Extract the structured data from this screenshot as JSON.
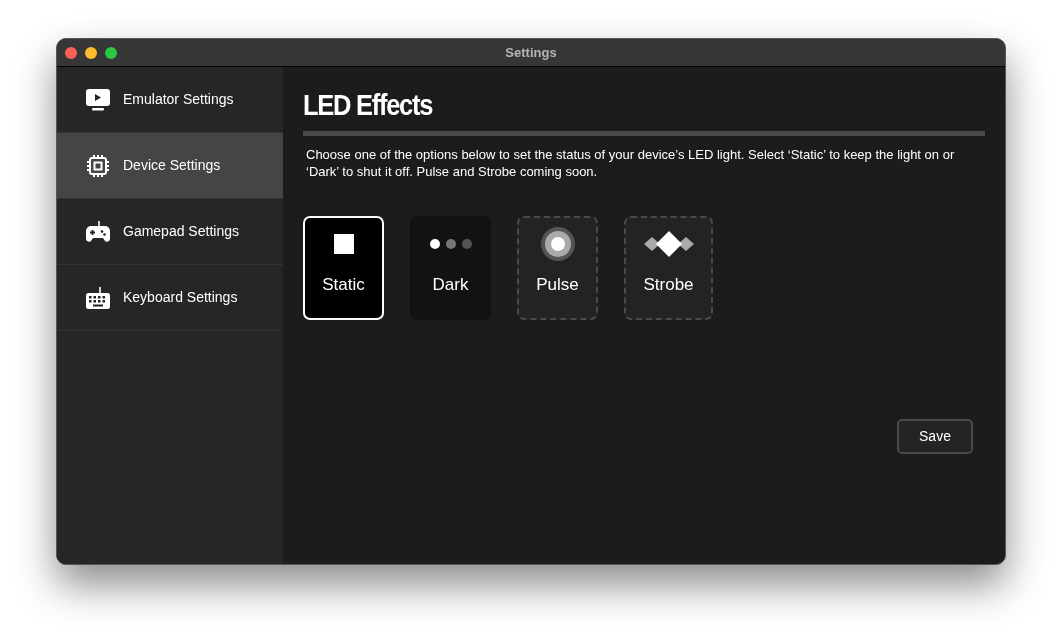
{
  "window": {
    "title": "Settings"
  },
  "sidebar": {
    "items": [
      {
        "label": "Emulator Settings",
        "kind": "screen",
        "selected": false
      },
      {
        "label": "Device Settings",
        "kind": "chip",
        "selected": true
      },
      {
        "label": "Gamepad Settings",
        "kind": "gamepad",
        "selected": false
      },
      {
        "label": "Keyboard Settings",
        "kind": "keyboard",
        "selected": false
      }
    ]
  },
  "content": {
    "title": "LED Effects",
    "description": "Choose one of the options below to set the status of your device’s LED light. Select ‘Static’ to keep the light on or ‘Dark’ to shut it off. Pulse and Strobe coming soon.",
    "options": [
      {
        "label": "Static",
        "kind": "square",
        "selected": true,
        "disabled": false
      },
      {
        "label": "Dark",
        "kind": "dots",
        "selected": false,
        "disabled": false
      },
      {
        "label": "Pulse",
        "kind": "ring",
        "selected": false,
        "disabled": true
      },
      {
        "label": "Strobe",
        "kind": "diamonds",
        "selected": false,
        "disabled": true
      }
    ],
    "save_button": "Save"
  }
}
